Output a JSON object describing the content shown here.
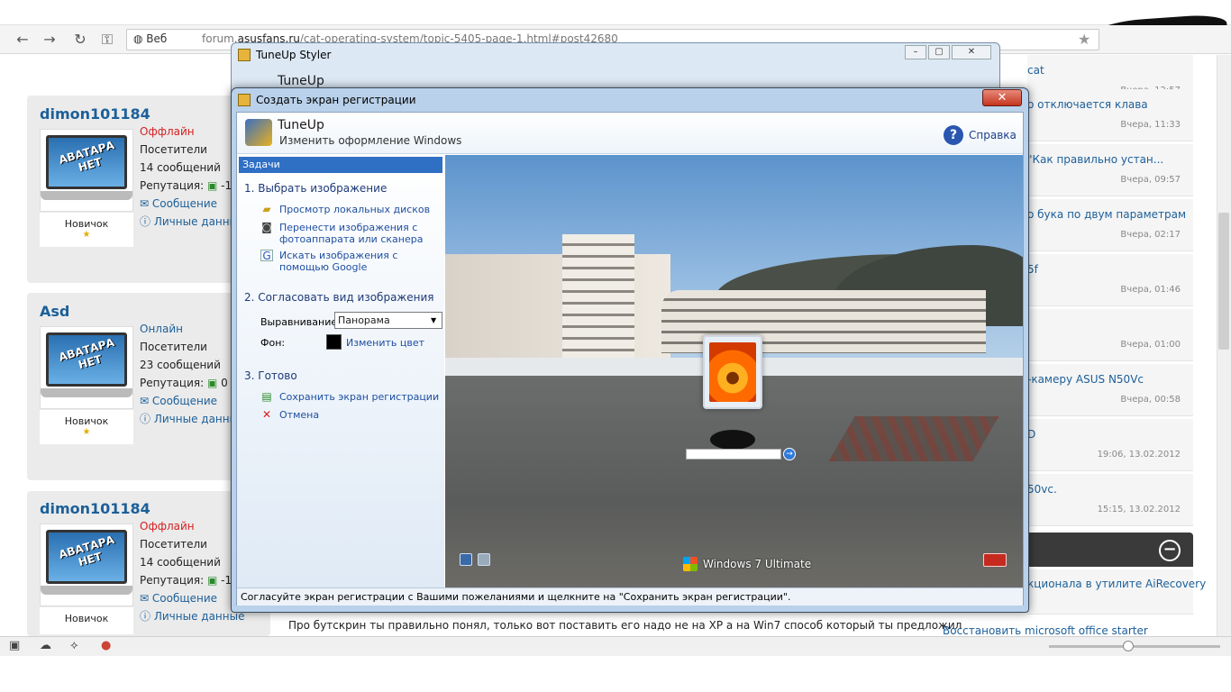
{
  "browser": {
    "search_engine_label": "Веб",
    "url_prefix": "forum.",
    "url_domain": "asusfans.ru",
    "url_path": "/cat-operating-system/topic-5405-page-1.html#post42680"
  },
  "posts": [
    {
      "username": "dimon101184",
      "status": "Оффлайн",
      "status_kind": "offline",
      "group": "Посетители",
      "messages": "14 сообщений",
      "reputation_label": "Репутация:",
      "reputation_value": "-1",
      "link_message": "Сообщение",
      "link_info": "Личные данные",
      "rank": "Новичок",
      "avatar_text": "АВАТАРА НЕТ"
    },
    {
      "username": "Asd",
      "status": "Онлайн",
      "status_kind": "online",
      "group": "Посетители",
      "messages": "23 сообщений",
      "reputation_label": "Репутация:",
      "reputation_value": "0",
      "link_message": "Сообщение",
      "link_info": "Личные данные",
      "rank": "Новичок",
      "avatar_text": "АВАТАРА НЕТ"
    },
    {
      "username": "dimon101184",
      "status": "Оффлайн",
      "status_kind": "offline",
      "group": "Посетители",
      "messages": "14 сообщений",
      "reputation_label": "Репутация:",
      "reputation_value": "-1",
      "link_message": "Сообщение",
      "link_info": "Личные данные",
      "rank": "Новичок",
      "avatar_text": "АВАТАРА НЕТ"
    }
  ],
  "right_topics": [
    {
      "title": "cat",
      "date": "Вчера, 12:57"
    },
    {
      "title": "о отключается клава",
      "date": "Вчера, 11:33"
    },
    {
      "title": "\"Как правильно устан...",
      "date": "Вчера, 09:57"
    },
    {
      "title": "о бука по двум параметрам",
      "date": "Вчера, 02:17"
    },
    {
      "title": "5f",
      "date": "Вчера, 01:46"
    },
    {
      "title": "",
      "date": "Вчера, 01:00"
    },
    {
      "title": "-камеру ASUS N50Vc",
      "date": "Вчера, 00:58"
    },
    {
      "title": "D",
      "date": "19:06, 13.02.2012"
    },
    {
      "title": "50vc.",
      "date": "15:15, 13.02.2012"
    }
  ],
  "right_bottom": {
    "item1": "кционала в утилите AiRecovery",
    "item2": "Восстановить microsoft office starter"
  },
  "below_post_text": "Про бутскрин ты правильно понял, только вот поставить его надо не на XP а на Win7 способ который ты предложил",
  "back_window": {
    "title": "TuneUp Styler",
    "app_name": "TuneUp"
  },
  "dialog": {
    "title": "Создать экран регистрации",
    "close_glyph": "✕",
    "app_name": "TuneUp",
    "subtitle": "Изменить оформление Windows",
    "help_label": "Справка",
    "tasks_header": "Задачи",
    "section1": "1. Выбрать изображение",
    "link_local": "Просмотр локальных дисков",
    "link_camera": "Перенести изображения с фотоаппарата или сканера",
    "link_google": "Искать изображения с помощью Google",
    "section2": "2. Согласовать вид изображения",
    "align_label": "Выравнивание:",
    "align_value": "Панорама",
    "bg_label": "Фон:",
    "bg_color": "#000000",
    "change_color": "Изменить цвет",
    "section3": "3. Готово",
    "save_label": "Сохранить экран регистрации",
    "cancel_label": "Отмена",
    "preview_os_label": "Windows 7 Ultimate",
    "hint": "Согласуйте экран регистрации с Вашими пожеланиями и щелкните на \"Сохранить экран регистрации\"."
  },
  "colors": {
    "link": "#1c5f99",
    "offline": "#d42020",
    "task_header": "#2f6fc4"
  }
}
